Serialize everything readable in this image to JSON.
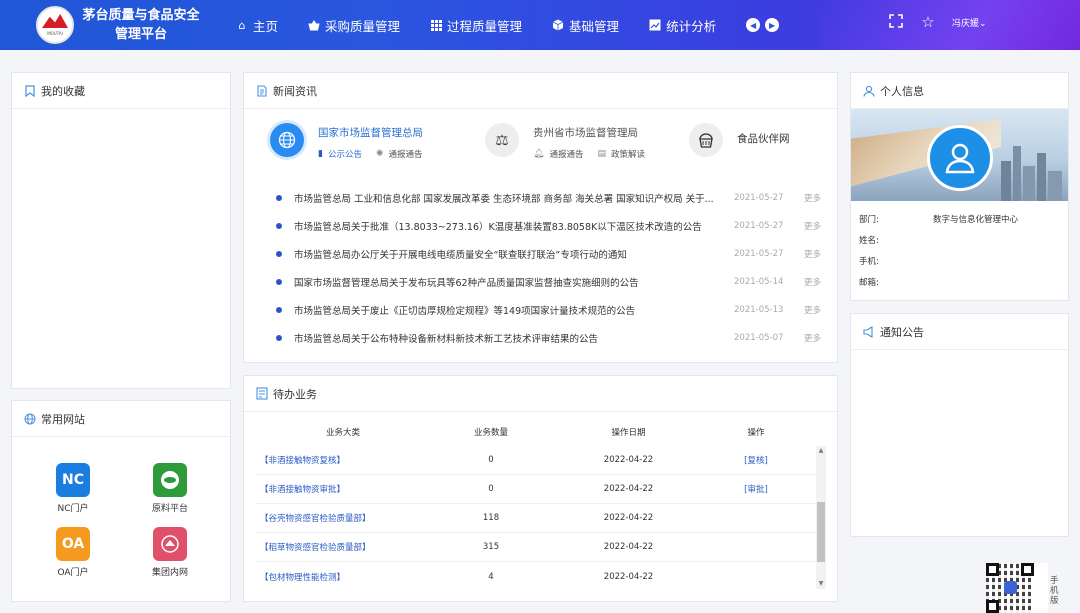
{
  "app": {
    "title_line1": "茅台质量与食品安全",
    "title_line2": "管理平台",
    "logo_text": "MOUTAI"
  },
  "nav": [
    {
      "label": "主页",
      "icon": "home-icon"
    },
    {
      "label": "采购质量管理",
      "icon": "basket-icon"
    },
    {
      "label": "过程质量管理",
      "icon": "grid-icon"
    },
    {
      "label": "基础管理",
      "icon": "cube-icon"
    },
    {
      "label": "统计分析",
      "icon": "chart-icon"
    }
  ],
  "header": {
    "user": "冯庆媛"
  },
  "favorites": {
    "title": "我的收藏"
  },
  "sites": {
    "title": "常用网站",
    "items": [
      {
        "label": "NC门户",
        "badge": "NC",
        "color": "#1a7de0"
      },
      {
        "label": "原料平台",
        "badge": "",
        "color": "#2e9a3a"
      },
      {
        "label": "OA门户",
        "badge": "OA",
        "color": "#f49a1e"
      },
      {
        "label": "集团内网",
        "badge": "",
        "color": "#e0506a"
      }
    ]
  },
  "news": {
    "title": "新闻资讯",
    "sources": [
      {
        "name": "国家市场监督管理总局",
        "subs": [
          "公示公告",
          "通报通告"
        ]
      },
      {
        "name": "贵州省市场监督管理局",
        "subs": [
          "通报通告",
          "政策解读"
        ]
      },
      {
        "name": "食品伙伴网",
        "subs": []
      }
    ],
    "more_label": "更多",
    "items": [
      {
        "title": "市场监管总局 工业和信息化部 国家发展改革委 生态环境部 商务部 海关总署 国家知识产权局 关于...",
        "date": "2021-05-27"
      },
      {
        "title": "市场监管总局关于批准（13.8033~273.16）K温度基准装置83.8058K以下温区技术改造的公告",
        "date": "2021-05-27"
      },
      {
        "title": "市场监管总局办公厅关于开展电线电缆质量安全“联查联打联治”专项行动的通知",
        "date": "2021-05-27"
      },
      {
        "title": "国家市场监督管理总局关于发布玩具等62种产品质量国家监督抽查实施细则的公告",
        "date": "2021-05-14"
      },
      {
        "title": "市场监管总局关于废止《正切齿厚规检定规程》等149项国家计量技术规范的公告",
        "date": "2021-05-13"
      },
      {
        "title": "市场监管总局关于公布特种设备新材料新技术新工艺技术评审结果的公告",
        "date": "2021-05-07"
      }
    ]
  },
  "todo": {
    "title": "待办业务",
    "columns": [
      "业务大类",
      "业务数量",
      "操作日期",
      "操作"
    ],
    "rows": [
      {
        "category": "【非酒接触物资复核】",
        "count": "0",
        "date": "2022-04-22",
        "action": "[复核]"
      },
      {
        "category": "【非酒接触物资审批】",
        "count": "0",
        "date": "2022-04-22",
        "action": "[审批]"
      },
      {
        "category": "【谷壳物资感官检验质量部】",
        "count": "118",
        "date": "2022-04-22",
        "action": ""
      },
      {
        "category": "【稻草物资感官检验质量部】",
        "count": "315",
        "date": "2022-04-22",
        "action": ""
      },
      {
        "category": "【包材物理性能检测】",
        "count": "4",
        "date": "2022-04-22",
        "action": ""
      }
    ]
  },
  "profile": {
    "title": "个人信息",
    "fields": [
      {
        "key": "部门:",
        "value": "数字与信息化管理中心"
      },
      {
        "key": "姓名:",
        "value": ""
      },
      {
        "key": "手机:",
        "value": ""
      },
      {
        "key": "邮箱:",
        "value": ""
      }
    ]
  },
  "notice": {
    "title": "通知公告"
  },
  "mobile_label": "手机版"
}
